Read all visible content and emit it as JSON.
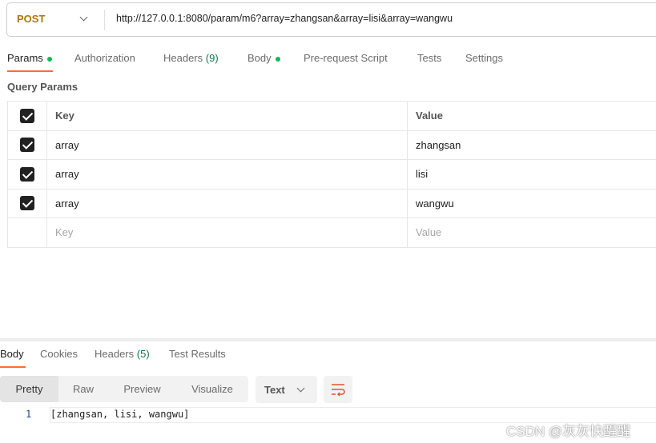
{
  "request": {
    "method": "POST",
    "url": "http://127.0.0.1:8080/param/m6?array=zhangsan&array=lisi&array=wangwu"
  },
  "tabs": [
    {
      "label": "Params"
    },
    {
      "label": "Authorization"
    },
    {
      "label": "Headers",
      "count": "(9)"
    },
    {
      "label": "Body"
    },
    {
      "label": "Pre-request Script"
    },
    {
      "label": "Tests"
    },
    {
      "label": "Settings"
    }
  ],
  "query_params": {
    "title": "Query Params",
    "headers": {
      "key": "Key",
      "value": "Value"
    },
    "rows": [
      {
        "key": "array",
        "value": "zhangsan",
        "checked": true
      },
      {
        "key": "array",
        "value": "lisi",
        "checked": true
      },
      {
        "key": "array",
        "value": "wangwu",
        "checked": true
      }
    ],
    "placeholder": {
      "key": "Key",
      "value": "Value"
    }
  },
  "response": {
    "tabs": [
      {
        "label": "Body"
      },
      {
        "label": "Cookies"
      },
      {
        "label": "Headers",
        "count": "(5)"
      },
      {
        "label": "Test Results"
      }
    ],
    "views": [
      "Pretty",
      "Raw",
      "Preview",
      "Visualize"
    ],
    "format": "Text",
    "lines": [
      {
        "num": "1",
        "text": "[zhangsan, lisi, wangwu]"
      }
    ]
  },
  "watermark": "CSDN @灰灰快醒醒",
  "colors": {
    "accent": "#ff6c37",
    "method": "#a77b00",
    "dot": "#0cbb52"
  }
}
